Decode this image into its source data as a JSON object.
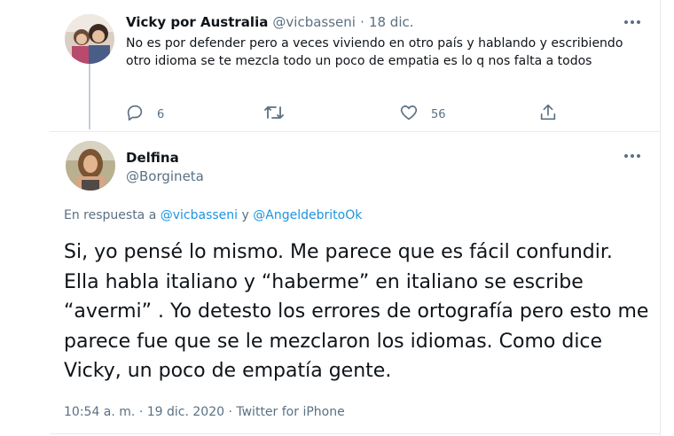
{
  "reply": {
    "name": "Vicky por Australia",
    "handle": "@vicbasseni",
    "separator": "·",
    "date": "18 dic.",
    "text": "No es por defender pero a veces viviendo en otro país y hablando y escribiendo otro idioma se te mezcla todo un poco de empatia es lo q nos falta a todos",
    "reply_count": "6",
    "like_count": "56"
  },
  "main": {
    "name": "Delfina",
    "handle": "@Borgineta",
    "in_reply_prefix": "En respuesta a",
    "in_reply_user1": "@vicbasseni",
    "in_reply_conj": "y",
    "in_reply_user2": "@AngeldebritoOk",
    "text": "Si, yo pensé lo mismo. Me parece que es fácil confundir. Ella habla italiano y “haberme” en italiano se escribe “avermi” . Yo detesto los errores de ortografía pero esto me parece fue que se le mezclaron los idiomas. Como dice Vicky, un poco de empatía gente.",
    "time": "10:54 a. m.",
    "meta_separator": "·",
    "date": "19 dic. 2020",
    "source": "Twitter for iPhone"
  },
  "icons": [
    "reply-icon",
    "retweet-icon",
    "like-icon",
    "share-icon",
    "more-icon"
  ],
  "colors": {
    "link": "#1b95e0",
    "secondary": "#5b7083",
    "text": "#0f1419",
    "border": "#e6ecf0"
  }
}
